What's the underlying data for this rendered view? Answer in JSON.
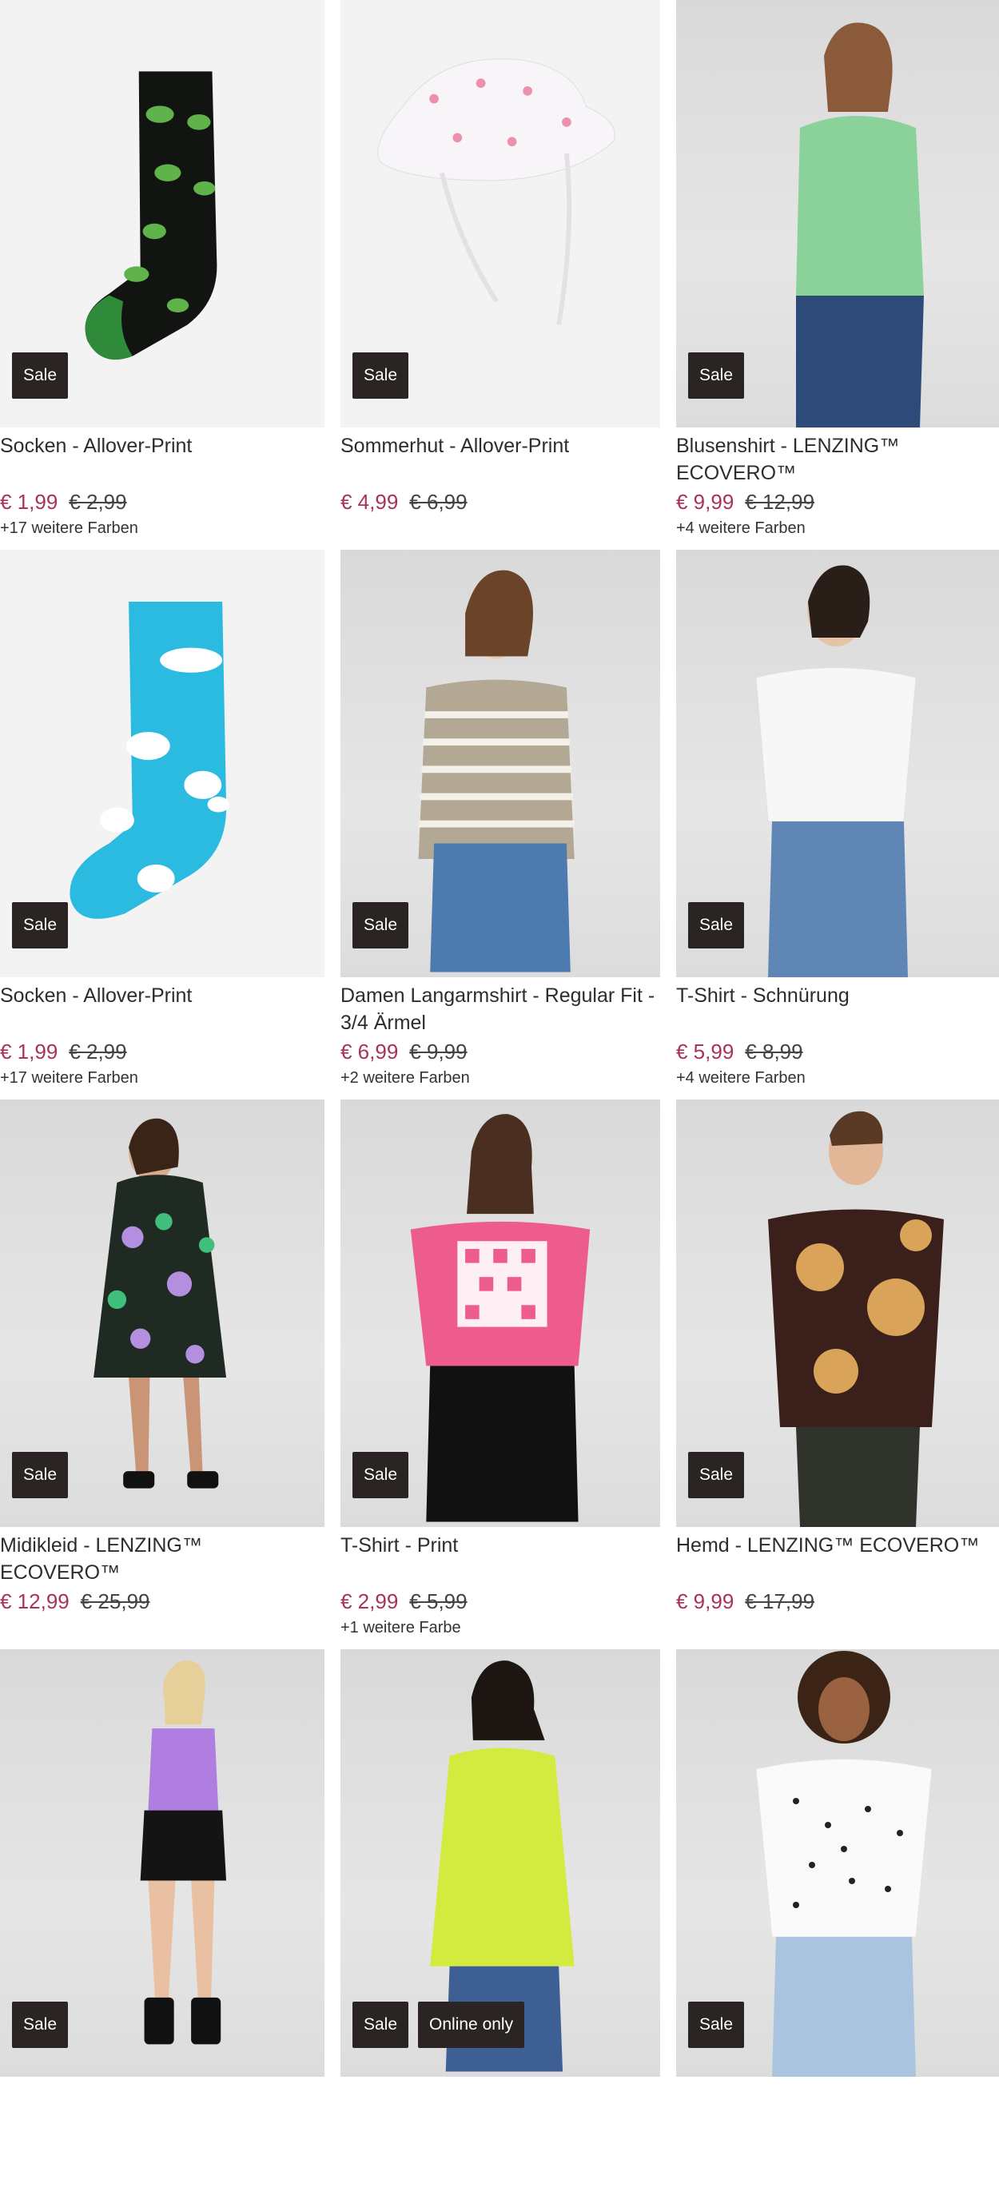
{
  "products": [
    {
      "title": "Socken - Allover-Print",
      "price": "€ 1,99",
      "old_price": "€ 2,99",
      "colors": "+17 weitere Farben",
      "badges": [
        "Sale"
      ]
    },
    {
      "title": "Sommerhut - Allover-Print",
      "price": "€ 4,99",
      "old_price": "€ 6,99",
      "colors": "",
      "badges": [
        "Sale"
      ]
    },
    {
      "title": "Blusenshirt - LENZING™ ECOVERO™",
      "price": "€ 9,99",
      "old_price": "€ 12,99",
      "colors": "+4 weitere Farben",
      "badges": [
        "Sale"
      ]
    },
    {
      "title": "Socken - Allover-Print",
      "price": "€ 1,99",
      "old_price": "€ 2,99",
      "colors": "+17 weitere Farben",
      "badges": [
        "Sale"
      ]
    },
    {
      "title": "Damen Langarmshirt - Regular Fit - 3/4 Ärmel",
      "price": "€ 6,99",
      "old_price": "€ 9,99",
      "colors": "+2 weitere Farben",
      "badges": [
        "Sale"
      ]
    },
    {
      "title": "T-Shirt - Schnürung",
      "price": "€ 5,99",
      "old_price": "€ 8,99",
      "colors": "+4 weitere Farben",
      "badges": [
        "Sale"
      ]
    },
    {
      "title": "Midikleid - LENZING™ ECOVERO™",
      "price": "€ 12,99",
      "old_price": "€ 25,99",
      "colors": "",
      "badges": [
        "Sale"
      ]
    },
    {
      "title": "T-Shirt - Print",
      "price": "€ 2,99",
      "old_price": "€ 5,99",
      "colors": "+1 weitere Farbe",
      "badges": [
        "Sale"
      ]
    },
    {
      "title": "Hemd - LENZING™ ECOVERO™",
      "price": "€ 9,99",
      "old_price": "€ 17,99",
      "colors": "",
      "badges": [
        "Sale"
      ]
    },
    {
      "title": "",
      "price": "",
      "old_price": "",
      "colors": "",
      "badges": [
        "Sale"
      ]
    },
    {
      "title": "",
      "price": "",
      "old_price": "",
      "colors": "",
      "badges": [
        "Sale",
        "Online only"
      ]
    },
    {
      "title": "",
      "price": "",
      "old_price": "",
      "colors": "",
      "badges": [
        "Sale"
      ]
    }
  ],
  "colors": {
    "sale_price": "#a8325a",
    "badge_bg": "#2a2423"
  }
}
